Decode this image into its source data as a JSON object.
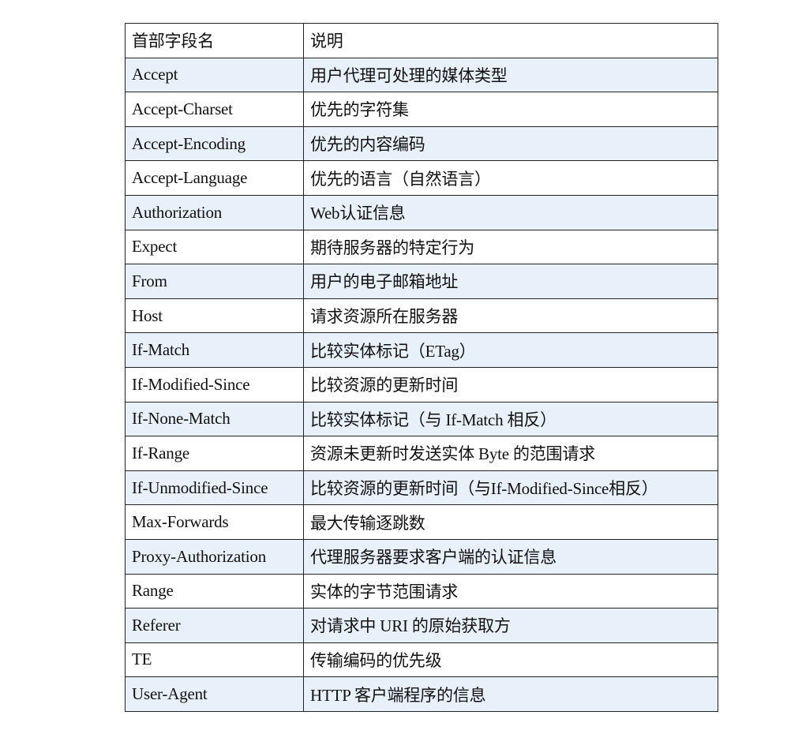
{
  "table": {
    "headers": [
      "首部字段名",
      "说明"
    ],
    "shade_color": "#e8f0fa",
    "rows": [
      {
        "field": "Accept",
        "desc": "用户代理可处理的媒体类型"
      },
      {
        "field": "Accept-Charset",
        "desc": "优先的字符集"
      },
      {
        "field": "Accept-Encoding",
        "desc": "优先的内容编码"
      },
      {
        "field": "Accept-Language",
        "desc": "优先的语言（自然语言）"
      },
      {
        "field": "Authorization",
        "desc": "Web认证信息"
      },
      {
        "field": "Expect",
        "desc": "期待服务器的特定行为"
      },
      {
        "field": "From",
        "desc": "用户的电子邮箱地址"
      },
      {
        "field": "Host",
        "desc": "请求资源所在服务器"
      },
      {
        "field": "If-Match",
        "desc": "比较实体标记（ETag）"
      },
      {
        "field": "If-Modified-Since",
        "desc": "比较资源的更新时间"
      },
      {
        "field": "If-None-Match",
        "desc": "比较实体标记（与 If-Match 相反）"
      },
      {
        "field": "If-Range",
        "desc": "资源未更新时发送实体 Byte 的范围请求"
      },
      {
        "field": "If-Unmodified-Since",
        "desc": "比较资源的更新时间（与If-Modified-Since相反）"
      },
      {
        "field": "Max-Forwards",
        "desc": "最大传输逐跳数"
      },
      {
        "field": "Proxy-Authorization",
        "desc": "代理服务器要求客户端的认证信息"
      },
      {
        "field": "Range",
        "desc": "实体的字节范围请求"
      },
      {
        "field": "Referer",
        "desc": "对请求中 URI 的原始获取方"
      },
      {
        "field": "TE",
        "desc": "传输编码的优先级"
      },
      {
        "field": "User-Agent",
        "desc": "HTTP 客户端程序的信息"
      }
    ]
  }
}
